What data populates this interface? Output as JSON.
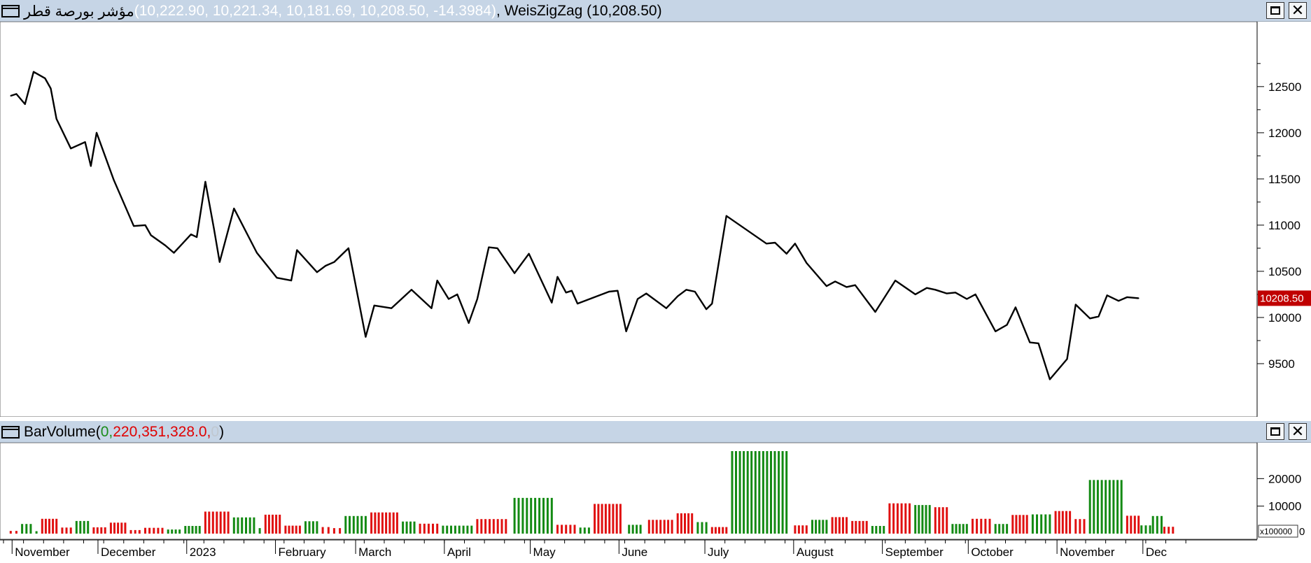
{
  "price_pane": {
    "symbol": "مؤشر بورصة قطر",
    "values_text": "(10,222.90, 10,221.34, 10,181.69, 10,208.50, -14.3984)",
    "indicator_text": ", WeisZigZag (10,208.50)",
    "last_value_label": "10208.50"
  },
  "volume_pane": {
    "name": "BarVolume",
    "open_paren": " (",
    "v1": "0,",
    "v2": " 220,351,328.0,",
    "v3": " 0",
    "close_paren": " )",
    "multiplier": "x100000",
    "zero_label": "0"
  },
  "window_buttons": {
    "maximize_icon": "maximize-icon",
    "close_icon": "close-icon",
    "close_glyph": "✕"
  },
  "colors": {
    "up": "#138a13",
    "down": "#e01010",
    "line": "#000000",
    "header_bg": "#c6d5e6",
    "last_label_bg": "#c00000"
  },
  "chart_data": [
    {
      "type": "line",
      "title": "",
      "series_name": "WeisZigZag",
      "y_axis_ticks": [
        "12500",
        "12000",
        "11500",
        "11000",
        "10500",
        "10000",
        "9500"
      ],
      "ylim": [
        9000,
        12900
      ],
      "x_axis_labels": [
        "November",
        "December",
        "2023",
        "February",
        "March",
        "April",
        "May",
        "June",
        "July",
        "August",
        "September",
        "October",
        "November",
        "Dec"
      ],
      "x": [
        "2022-11-01",
        "2022-11-03",
        "2022-11-06",
        "2022-11-09",
        "2022-11-13",
        "2022-11-15",
        "2022-11-17",
        "2022-11-22",
        "2022-11-27",
        "2022-11-29",
        "2022-12-01",
        "2022-12-07",
        "2022-12-14",
        "2022-12-18",
        "2022-12-20",
        "2022-12-25",
        "2022-12-28",
        "2023-01-03",
        "2023-01-05",
        "2023-01-08",
        "2023-01-11",
        "2023-01-13",
        "2023-01-18",
        "2023-01-26",
        "2023-02-02",
        "2023-02-07",
        "2023-02-09",
        "2023-02-16",
        "2023-02-19",
        "2023-02-22",
        "2023-02-27",
        "2023-03-05",
        "2023-03-08",
        "2023-03-14",
        "2023-03-21",
        "2023-03-28",
        "2023-03-30",
        "2023-04-03",
        "2023-04-06",
        "2023-04-10",
        "2023-04-13",
        "2023-04-17",
        "2023-04-20",
        "2023-04-26",
        "2023-05-01",
        "2023-05-09",
        "2023-05-11",
        "2023-05-14",
        "2023-05-16",
        "2023-05-18",
        "2023-05-29",
        "2023-06-01",
        "2023-06-04",
        "2023-06-08",
        "2023-06-11",
        "2023-06-18",
        "2023-06-22",
        "2023-06-25",
        "2023-06-28",
        "2023-07-02",
        "2023-07-04",
        "2023-07-09",
        "2023-07-23",
        "2023-07-26",
        "2023-07-30",
        "2023-08-02",
        "2023-08-06",
        "2023-08-13",
        "2023-08-16",
        "2023-08-20",
        "2023-08-23",
        "2023-08-30",
        "2023-09-06",
        "2023-09-13",
        "2023-09-17",
        "2023-09-20",
        "2023-09-24",
        "2023-09-27",
        "2023-10-01",
        "2023-10-04",
        "2023-10-11",
        "2023-10-15",
        "2023-10-18",
        "2023-10-23",
        "2023-10-26",
        "2023-10-30",
        "2023-11-05",
        "2023-11-08",
        "2023-11-13",
        "2023-11-16",
        "2023-11-19",
        "2023-11-23",
        "2023-11-26",
        "2023-11-30"
      ],
      "y": [
        12400,
        12420,
        12310,
        12660,
        12590,
        12480,
        12150,
        11830,
        11900,
        11640,
        12000,
        11490,
        10990,
        11000,
        10890,
        10780,
        10700,
        10900,
        10870,
        11470,
        10960,
        10600,
        11180,
        10700,
        10430,
        10400,
        10730,
        10490,
        10560,
        10600,
        10750,
        9790,
        10130,
        10100,
        10300,
        10100,
        10400,
        10200,
        10250,
        9940,
        10200,
        10760,
        10750,
        10480,
        10690,
        10160,
        10440,
        10270,
        10290,
        10150,
        10280,
        10290,
        9850,
        10200,
        10260,
        10100,
        10230,
        10300,
        10280,
        10090,
        10150,
        11100,
        10800,
        10810,
        10690,
        10800,
        10590,
        10340,
        10390,
        10330,
        10350,
        10060,
        10400,
        10250,
        10320,
        10300,
        10260,
        10270,
        10200,
        10250,
        9850,
        9920,
        10110,
        9730,
        9720,
        9330,
        9550,
        10140,
        9990,
        10010,
        10240,
        10180,
        10220,
        10208.5
      ]
    },
    {
      "type": "bar",
      "title": "",
      "series_name": "BarVolume",
      "y_axis_ticks": [
        "20000",
        "10000"
      ],
      "ylim": [
        0,
        30000
      ],
      "value_groups": [
        {
          "from": "2022-11-01",
          "to": "2022-11-03",
          "value": 1000,
          "dir": "down"
        },
        {
          "from": "2022-11-05",
          "to": "2022-11-08",
          "value": 3500,
          "dir": "up"
        },
        {
          "from": "2022-11-10",
          "to": "2022-11-10",
          "value": 900,
          "dir": "up"
        },
        {
          "from": "2022-11-12",
          "to": "2022-11-17",
          "value": 5400,
          "dir": "down"
        },
        {
          "from": "2022-11-19",
          "to": "2022-11-22",
          "value": 2200,
          "dir": "down"
        },
        {
          "from": "2022-11-24",
          "to": "2022-11-28",
          "value": 4600,
          "dir": "up"
        },
        {
          "from": "2022-11-30",
          "to": "2022-12-04",
          "value": 2300,
          "dir": "down"
        },
        {
          "from": "2022-12-06",
          "to": "2022-12-11",
          "value": 4000,
          "dir": "down"
        },
        {
          "from": "2022-12-13",
          "to": "2022-12-16",
          "value": 1300,
          "dir": "down"
        },
        {
          "from": "2022-12-18",
          "to": "2022-12-24",
          "value": 2100,
          "dir": "down"
        },
        {
          "from": "2022-12-26",
          "to": "2022-12-30",
          "value": 1500,
          "dir": "up"
        },
        {
          "from": "2023-01-01",
          "to": "2023-01-06",
          "value": 2800,
          "dir": "up"
        },
        {
          "from": "2023-01-08",
          "to": "2023-01-16",
          "value": 8000,
          "dir": "down"
        },
        {
          "from": "2023-01-18",
          "to": "2023-01-25",
          "value": 5900,
          "dir": "up"
        },
        {
          "from": "2023-01-27",
          "to": "2023-01-27",
          "value": 2000,
          "dir": "up"
        },
        {
          "from": "2023-01-29",
          "to": "2023-02-03",
          "value": 6900,
          "dir": "down"
        },
        {
          "from": "2023-02-05",
          "to": "2023-02-10",
          "value": 2900,
          "dir": "down"
        },
        {
          "from": "2023-02-12",
          "to": "2023-02-16",
          "value": 4500,
          "dir": "up"
        },
        {
          "from": "2023-02-18",
          "to": "2023-02-20",
          "value": 2400,
          "dir": "down"
        },
        {
          "from": "2023-02-22",
          "to": "2023-02-24",
          "value": 2000,
          "dir": "down"
        },
        {
          "from": "2023-02-26",
          "to": "2023-03-05",
          "value": 6400,
          "dir": "up"
        },
        {
          "from": "2023-03-07",
          "to": "2023-03-16",
          "value": 7700,
          "dir": "down"
        },
        {
          "from": "2023-03-18",
          "to": "2023-03-22",
          "value": 4400,
          "dir": "up"
        },
        {
          "from": "2023-03-24",
          "to": "2023-03-30",
          "value": 3600,
          "dir": "down"
        },
        {
          "from": "2023-04-01",
          "to": "2023-04-11",
          "value": 2900,
          "dir": "up"
        },
        {
          "from": "2023-04-13",
          "to": "2023-04-23",
          "value": 5300,
          "dir": "down"
        },
        {
          "from": "2023-04-26",
          "to": "2023-05-09",
          "value": 13000,
          "dir": "up"
        },
        {
          "from": "2023-05-11",
          "to": "2023-05-17",
          "value": 3200,
          "dir": "down"
        },
        {
          "from": "2023-05-19",
          "to": "2023-05-22",
          "value": 2200,
          "dir": "up"
        },
        {
          "from": "2023-05-24",
          "to": "2023-06-02",
          "value": 10800,
          "dir": "down"
        },
        {
          "from": "2023-06-05",
          "to": "2023-06-09",
          "value": 3200,
          "dir": "up"
        },
        {
          "from": "2023-06-12",
          "to": "2023-06-20",
          "value": 5000,
          "dir": "down"
        },
        {
          "from": "2023-06-22",
          "to": "2023-06-27",
          "value": 7400,
          "dir": "down"
        },
        {
          "from": "2023-06-29",
          "to": "2023-07-02",
          "value": 4200,
          "dir": "up"
        },
        {
          "from": "2023-07-04",
          "to": "2023-07-09",
          "value": 2400,
          "dir": "down"
        },
        {
          "from": "2023-07-11",
          "to": "2023-07-30",
          "value": 30000,
          "dir": "up"
        },
        {
          "from": "2023-08-02",
          "to": "2023-08-06",
          "value": 3000,
          "dir": "down"
        },
        {
          "from": "2023-08-08",
          "to": "2023-08-13",
          "value": 5000,
          "dir": "up"
        },
        {
          "from": "2023-08-15",
          "to": "2023-08-20",
          "value": 6000,
          "dir": "down"
        },
        {
          "from": "2023-08-22",
          "to": "2023-08-27",
          "value": 4600,
          "dir": "down"
        },
        {
          "from": "2023-08-29",
          "to": "2023-09-02",
          "value": 2800,
          "dir": "up"
        },
        {
          "from": "2023-09-04",
          "to": "2023-09-11",
          "value": 11000,
          "dir": "down"
        },
        {
          "from": "2023-09-13",
          "to": "2023-09-18",
          "value": 10400,
          "dir": "up"
        },
        {
          "from": "2023-09-20",
          "to": "2023-09-24",
          "value": 9600,
          "dir": "down"
        },
        {
          "from": "2023-09-26",
          "to": "2023-10-01",
          "value": 3500,
          "dir": "up"
        },
        {
          "from": "2023-10-03",
          "to": "2023-10-09",
          "value": 5400,
          "dir": "down"
        },
        {
          "from": "2023-10-11",
          "to": "2023-10-15",
          "value": 3500,
          "dir": "up"
        },
        {
          "from": "2023-10-17",
          "to": "2023-10-22",
          "value": 6800,
          "dir": "down"
        },
        {
          "from": "2023-10-24",
          "to": "2023-10-30",
          "value": 7000,
          "dir": "up"
        },
        {
          "from": "2023-11-01",
          "to": "2023-11-06",
          "value": 8200,
          "dir": "down"
        },
        {
          "from": "2023-11-08",
          "to": "2023-11-11",
          "value": 5300,
          "dir": "down"
        },
        {
          "from": "2023-11-13",
          "to": "2023-11-24",
          "value": 19500,
          "dir": "up"
        },
        {
          "from": "2023-11-26",
          "to": "2023-11-30",
          "value": 6500,
          "dir": "down"
        },
        {
          "from": "2023-12-01",
          "to": "2023-12-04",
          "value": 3000,
          "dir": "up"
        },
        {
          "from": "2023-12-05",
          "to": "2023-12-08",
          "value": 6400,
          "dir": "up"
        },
        {
          "from": "2023-12-09",
          "to": "2023-12-12",
          "value": 2500,
          "dir": "down"
        }
      ]
    }
  ]
}
